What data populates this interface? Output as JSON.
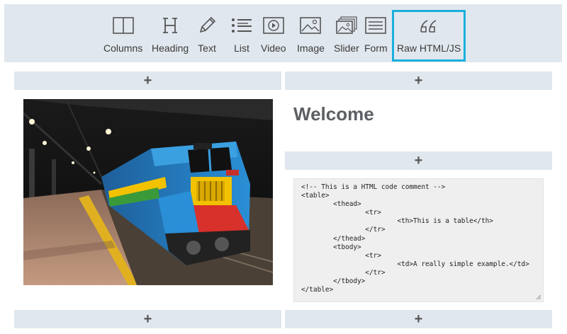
{
  "toolbar": {
    "items": [
      {
        "label": "Columns",
        "icon": "columns-icon"
      },
      {
        "label": "Heading",
        "icon": "heading-icon"
      },
      {
        "label": "Text",
        "icon": "pencil-icon"
      },
      {
        "label": "List",
        "icon": "list-icon"
      },
      {
        "label": "Video",
        "icon": "video-icon"
      },
      {
        "label": "Image",
        "icon": "image-icon"
      },
      {
        "label": "Slider",
        "icon": "slider-icon"
      },
      {
        "label": "Form",
        "icon": "form-icon"
      },
      {
        "label": "Raw HTML/JS",
        "icon": "quote-icon",
        "active": true
      }
    ],
    "accent": "#1ab0dd",
    "background": "#e1e7ee"
  },
  "add_symbol": "+",
  "content": {
    "heading": "Welcome",
    "code_lines": [
      "<!-- This is a HTML code comment -->",
      "<table>",
      "        <thead>",
      "                <tr>",
      "                        <th>This is a table</th>",
      "                </tr>",
      "        </thead>",
      "        <tbody>",
      "                <tr>",
      "                        <td>A really simple example.</td>",
      "                </tr>",
      "        </tbody>",
      "</table>"
    ]
  }
}
